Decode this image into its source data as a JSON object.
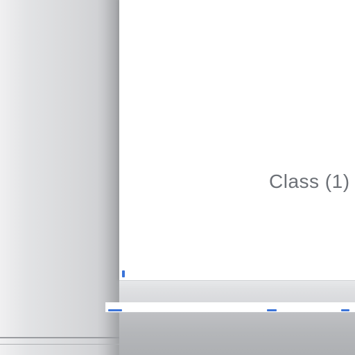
{
  "panel": {
    "label": "Class (1)"
  },
  "colors": {
    "accent": "#3b74d9",
    "panel_background": "#ffffff",
    "label_text": "#6c7076"
  }
}
